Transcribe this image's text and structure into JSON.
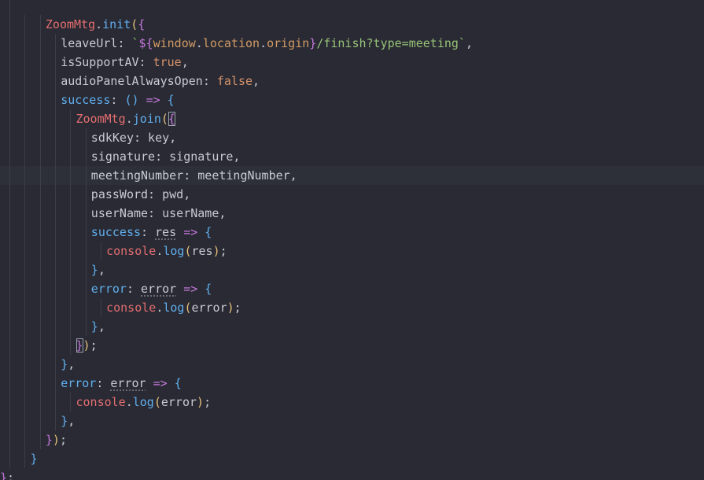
{
  "editor": {
    "language": "javascript",
    "colors": {
      "background": "#292a33",
      "active_line": "#2e3039",
      "object": "#e36e71",
      "function": "#61afef",
      "boolean": "#d7936b",
      "string": "#98c379",
      "keyword": "#c678dd",
      "bracket_1": "#e5c07b"
    },
    "lines": [
      {
        "indent": 3,
        "tokens": [
          [
            "obj",
            "ZoomMtg"
          ],
          [
            "punc",
            "."
          ],
          [
            "fn",
            "init"
          ],
          [
            "b1",
            "("
          ],
          [
            "b2",
            "{"
          ]
        ]
      },
      {
        "indent": 4,
        "tokens": [
          [
            "key",
            "leaveUrl"
          ],
          [
            "punc",
            ": "
          ],
          [
            "str",
            "`"
          ],
          [
            "tmpl",
            "${"
          ],
          [
            "var",
            "window"
          ],
          [
            "punc",
            "."
          ],
          [
            "var",
            "location"
          ],
          [
            "punc",
            "."
          ],
          [
            "var",
            "origin"
          ],
          [
            "tmpl",
            "}"
          ],
          [
            "str",
            "/finish?type=meeting`"
          ],
          [
            "punc",
            ","
          ]
        ]
      },
      {
        "indent": 4,
        "tokens": [
          [
            "key",
            "isSupportAV"
          ],
          [
            "punc",
            ": "
          ],
          [
            "bool",
            "true"
          ],
          [
            "punc",
            ","
          ]
        ]
      },
      {
        "indent": 4,
        "tokens": [
          [
            "key",
            "audioPanelAlwaysOpen"
          ],
          [
            "punc",
            ": "
          ],
          [
            "bool",
            "false"
          ],
          [
            "punc",
            ","
          ]
        ]
      },
      {
        "indent": 4,
        "tokens": [
          [
            "fn",
            "success"
          ],
          [
            "punc",
            ": "
          ],
          [
            "b3",
            "()"
          ],
          [
            "punc",
            " "
          ],
          [
            "arrow",
            "=>"
          ],
          [
            "punc",
            " "
          ],
          [
            "b3",
            "{"
          ]
        ]
      },
      {
        "indent": 5,
        "tokens": [
          [
            "obj",
            "ZoomMtg"
          ],
          [
            "punc",
            "."
          ],
          [
            "fn",
            "join"
          ],
          [
            "b1",
            "("
          ],
          [
            "b2m",
            "{"
          ]
        ]
      },
      {
        "indent": 6,
        "tokens": [
          [
            "key",
            "sdkKey"
          ],
          [
            "punc",
            ": "
          ],
          [
            "ident",
            "key"
          ],
          [
            "punc",
            ","
          ]
        ]
      },
      {
        "indent": 6,
        "tokens": [
          [
            "key",
            "signature"
          ],
          [
            "punc",
            ": "
          ],
          [
            "ident",
            "signature"
          ],
          [
            "punc",
            ","
          ]
        ]
      },
      {
        "indent": 6,
        "active": true,
        "tokens": [
          [
            "key",
            "meetingNumber"
          ],
          [
            "punc",
            ": "
          ],
          [
            "ident",
            "meetingNumber"
          ],
          [
            "punc",
            ","
          ]
        ]
      },
      {
        "indent": 6,
        "tokens": [
          [
            "key",
            "passWord"
          ],
          [
            "punc",
            ": "
          ],
          [
            "ident",
            "pwd"
          ],
          [
            "punc",
            ","
          ]
        ]
      },
      {
        "indent": 6,
        "tokens": [
          [
            "key",
            "userName"
          ],
          [
            "punc",
            ": "
          ],
          [
            "ident",
            "userName"
          ],
          [
            "punc",
            ","
          ]
        ]
      },
      {
        "indent": 6,
        "tokens": [
          [
            "fn",
            "success"
          ],
          [
            "punc",
            ": "
          ],
          [
            "dots",
            "res"
          ],
          [
            "punc",
            " "
          ],
          [
            "arrow",
            "=>"
          ],
          [
            "punc",
            " "
          ],
          [
            "b3",
            "{"
          ]
        ]
      },
      {
        "indent": 7,
        "tokens": [
          [
            "obj",
            "console"
          ],
          [
            "punc",
            "."
          ],
          [
            "fn",
            "log"
          ],
          [
            "b1",
            "("
          ],
          [
            "ident",
            "res"
          ],
          [
            "b1",
            ")"
          ],
          [
            "punc",
            ";"
          ]
        ]
      },
      {
        "indent": 6,
        "tokens": [
          [
            "b3",
            "}"
          ],
          [
            "punc",
            ","
          ]
        ]
      },
      {
        "indent": 6,
        "tokens": [
          [
            "fn",
            "error"
          ],
          [
            "punc",
            ": "
          ],
          [
            "dots",
            "error"
          ],
          [
            "punc",
            " "
          ],
          [
            "arrow",
            "=>"
          ],
          [
            "punc",
            " "
          ],
          [
            "b3",
            "{"
          ]
        ]
      },
      {
        "indent": 7,
        "tokens": [
          [
            "obj",
            "console"
          ],
          [
            "punc",
            "."
          ],
          [
            "fn",
            "log"
          ],
          [
            "b1",
            "("
          ],
          [
            "ident",
            "error"
          ],
          [
            "b1",
            ")"
          ],
          [
            "punc",
            ";"
          ]
        ]
      },
      {
        "indent": 6,
        "tokens": [
          [
            "b3",
            "}"
          ],
          [
            "punc",
            ","
          ]
        ]
      },
      {
        "indent": 5,
        "tokens": [
          [
            "b2m",
            "}"
          ],
          [
            "b1",
            ")"
          ],
          [
            "punc",
            ";"
          ]
        ]
      },
      {
        "indent": 4,
        "tokens": [
          [
            "b3",
            "}"
          ],
          [
            "punc",
            ","
          ]
        ]
      },
      {
        "indent": 4,
        "tokens": [
          [
            "fn",
            "error"
          ],
          [
            "punc",
            ": "
          ],
          [
            "dots",
            "error"
          ],
          [
            "punc",
            " "
          ],
          [
            "arrow",
            "=>"
          ],
          [
            "punc",
            " "
          ],
          [
            "b3",
            "{"
          ]
        ]
      },
      {
        "indent": 5,
        "tokens": [
          [
            "obj",
            "console"
          ],
          [
            "punc",
            "."
          ],
          [
            "fn",
            "log"
          ],
          [
            "b1",
            "("
          ],
          [
            "ident",
            "error"
          ],
          [
            "b1",
            ")"
          ],
          [
            "punc",
            ";"
          ]
        ]
      },
      {
        "indent": 4,
        "tokens": [
          [
            "b3",
            "}"
          ],
          [
            "punc",
            ","
          ]
        ]
      },
      {
        "indent": 3,
        "tokens": [
          [
            "b2",
            "}"
          ],
          [
            "b1",
            ")"
          ],
          [
            "punc",
            ";"
          ]
        ]
      },
      {
        "indent": 2,
        "tokens": [
          [
            "b3",
            "}"
          ]
        ]
      },
      {
        "indent": 0,
        "tokens": [
          [
            "b2",
            "}"
          ],
          [
            "punc",
            ";"
          ]
        ]
      }
    ]
  }
}
